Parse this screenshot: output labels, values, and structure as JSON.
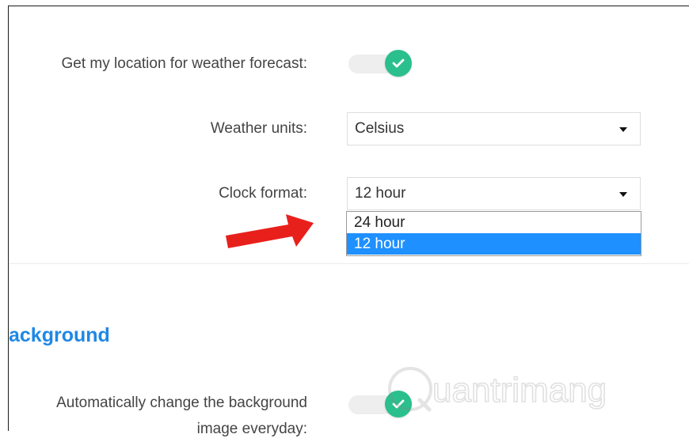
{
  "settings": {
    "location_label": "Get my location for weather forecast:",
    "units_label": "Weather units:",
    "units_value": "Celsius",
    "clock_label": "Clock format:",
    "clock_value": "12 hour",
    "clock_options": [
      {
        "label": "24 hour",
        "selected": false
      },
      {
        "label": "12 hour",
        "selected": true
      }
    ]
  },
  "background_section": {
    "title": "ackground",
    "auto_change_label_line1": "Automatically change the background",
    "auto_change_label_line2": "image everyday:"
  },
  "watermark": {
    "text": "uantrimang"
  },
  "colors": {
    "toggle_on": "#2bbf8e",
    "accent_blue": "#1e88e5",
    "selection_blue": "#1e90ff",
    "arrow_red": "#e8201c"
  },
  "icons": {
    "toggle_knob": "check-icon",
    "select_caret": "caret-down-icon",
    "annotation": "red-arrow-icon"
  }
}
